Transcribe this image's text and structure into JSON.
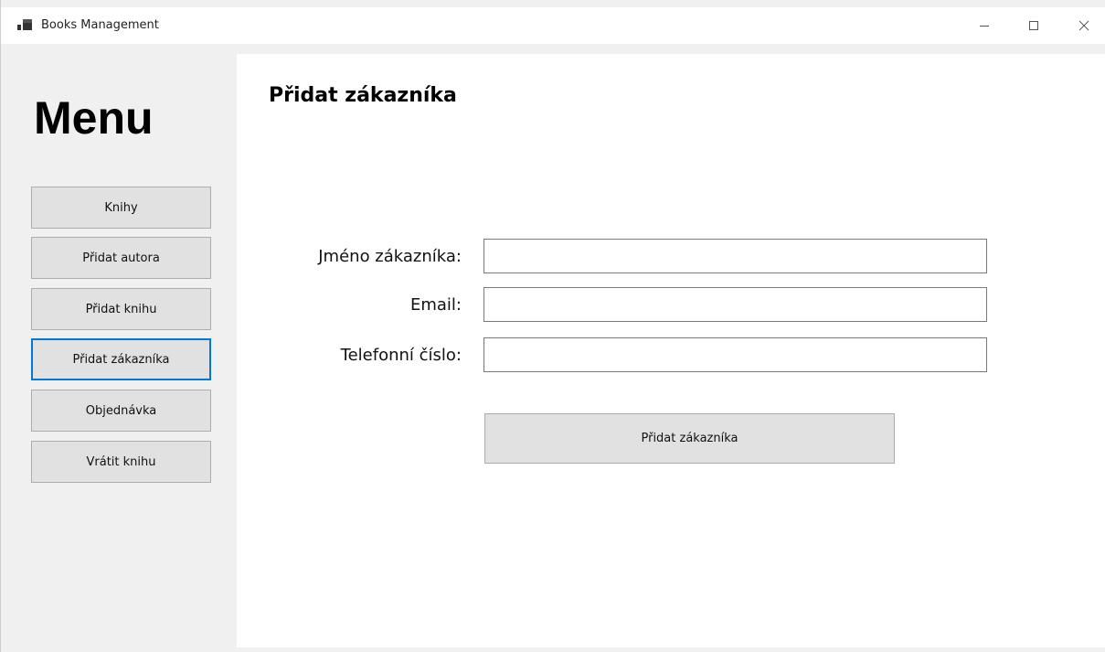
{
  "window": {
    "title": "Books Management",
    "icon": "app-window-icon",
    "controls": {
      "minimize": "minimize-icon",
      "maximize": "maximize-icon",
      "close": "close-icon"
    }
  },
  "sidebar": {
    "heading": "Menu",
    "items": [
      {
        "label": "Knihy"
      },
      {
        "label": "Přidat autora"
      },
      {
        "label": "Přidat knihu"
      },
      {
        "label": "Přidat zákazníka"
      },
      {
        "label": "Objednávka"
      },
      {
        "label": "Vrátit knihu"
      }
    ],
    "focused_index": 3
  },
  "form": {
    "title": "Přidat zákazníka",
    "fields": [
      {
        "label": "Jméno zákazníka:",
        "value": ""
      },
      {
        "label": "Email:",
        "value": ""
      },
      {
        "label": "Telefonní číslo:",
        "value": ""
      }
    ],
    "submit_label": "Přidat zákazníka"
  },
  "colors": {
    "focus_border": "#0078d7",
    "button_face": "#e1e1e1",
    "panel_bg": "#f0f0f0"
  }
}
